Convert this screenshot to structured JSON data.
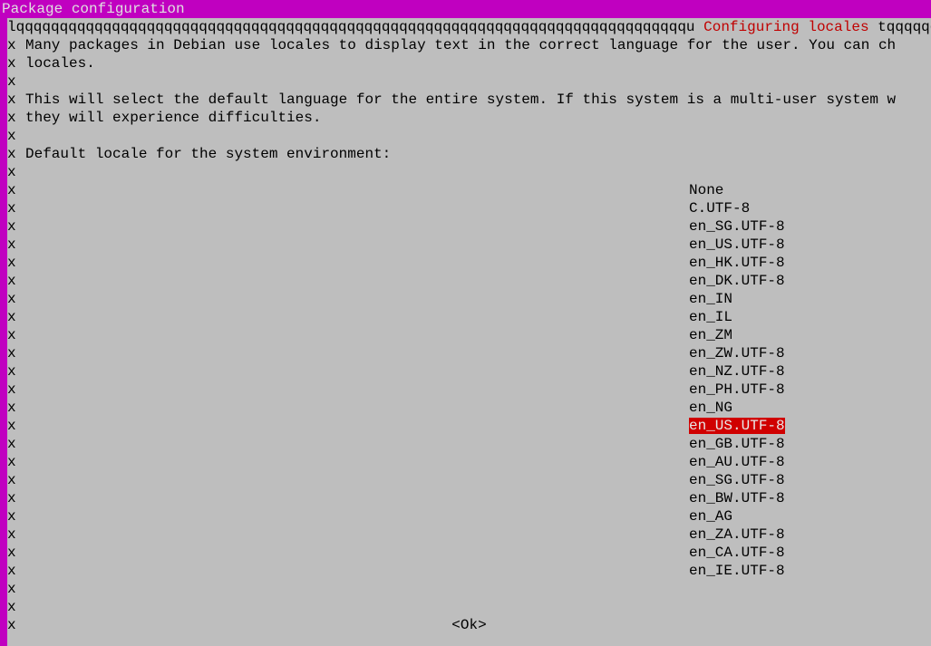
{
  "titlebar": "Package configuration",
  "dialog": {
    "border_left": "lqqqqqqqqqqqqqqqqqqqqqqqqqqqqqqqqqqqqqqqqqqqqqqqqqqqqqqqqqqqqqqqqqqqqqqqqqqqqqu ",
    "title": "Configuring locales",
    "border_right": " tqqqqqqqqqqqq",
    "body": [
      "Many packages in Debian use locales to display text in the correct language for the user. You can ch",
      "locales.",
      "",
      "This will select the default language for the entire system. If this system is a multi-user system w",
      "they will experience difficulties.",
      "",
      "Default locale for the system environment:"
    ],
    "locales": [
      "None",
      "C.UTF-8",
      "en_SG.UTF-8",
      "en_US.UTF-8",
      "en_HK.UTF-8",
      "en_DK.UTF-8",
      "en_IN",
      "en_IL",
      "en_ZM",
      "en_ZW.UTF-8",
      "en_NZ.UTF-8",
      "en_PH.UTF-8",
      "en_NG",
      "en_US.UTF-8",
      "en_GB.UTF-8",
      "en_AU.UTF-8",
      "en_SG.UTF-8",
      "en_BW.UTF-8",
      "en_AG",
      "en_ZA.UTF-8",
      "en_CA.UTF-8",
      "en_IE.UTF-8"
    ],
    "selected_index": 13,
    "ok_label": "<Ok>"
  },
  "border_char": "x"
}
